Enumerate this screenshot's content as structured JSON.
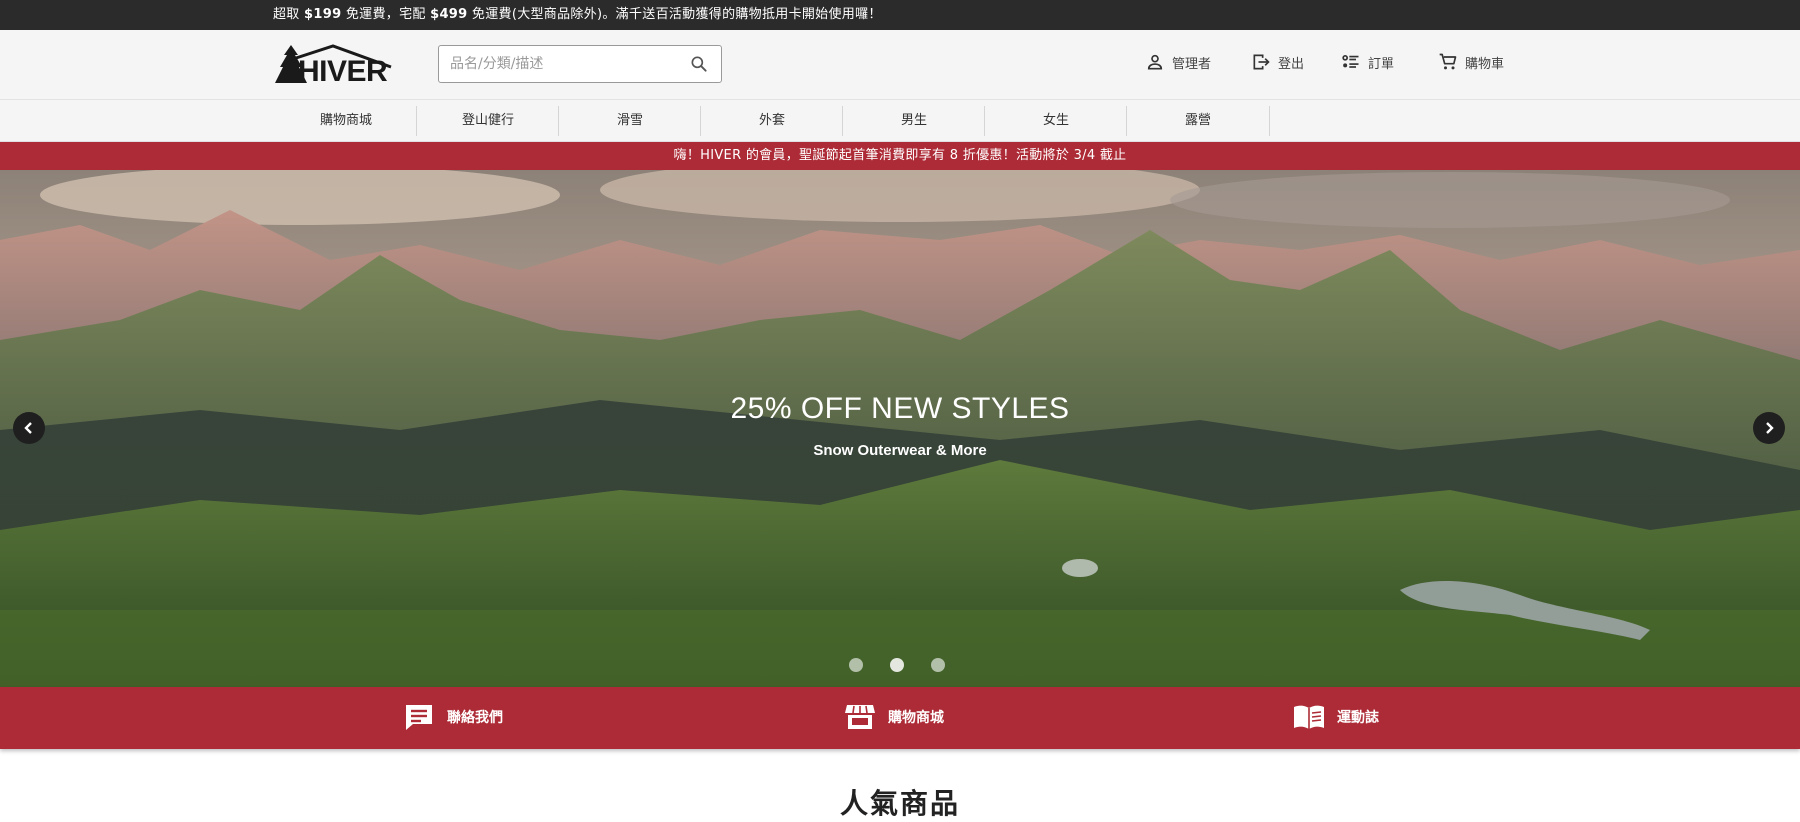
{
  "topbar": {
    "parts": [
      "超取 ",
      "$199",
      " 免運費，宅配 ",
      "$499",
      " 免運費(大型商品除外)。滿千送百活動獲得的購物抵用卡開始使用囉！"
    ]
  },
  "header": {
    "logo_text": "HIVER",
    "search_placeholder": "品名/分類/描述",
    "links": {
      "admin": "管理者",
      "logout": "登出",
      "orders": "訂單",
      "cart": "購物車"
    }
  },
  "category_nav": [
    "購物商城",
    "登山健行",
    "滑雪",
    "外套",
    "男生",
    "女生",
    "露營"
  ],
  "promo_banner": "嗨！HIVER 的會員，聖誕節起首筆消費即享有 8 折優惠！活動將於 3/4 截止",
  "hero": {
    "title": "25% OFF NEW STYLES",
    "subtitle": "Snow Outerwear & More",
    "slide_count": 3,
    "active_slide": 2
  },
  "quick_links": {
    "contact": "聯絡我們",
    "shop": "購物商城",
    "journal": "運動誌"
  },
  "section": {
    "title": "人氣商品"
  },
  "colors": {
    "brand_red": "#ad2b36",
    "topbar": "#2b2b2b",
    "header_bg": "#f5f5f5"
  }
}
